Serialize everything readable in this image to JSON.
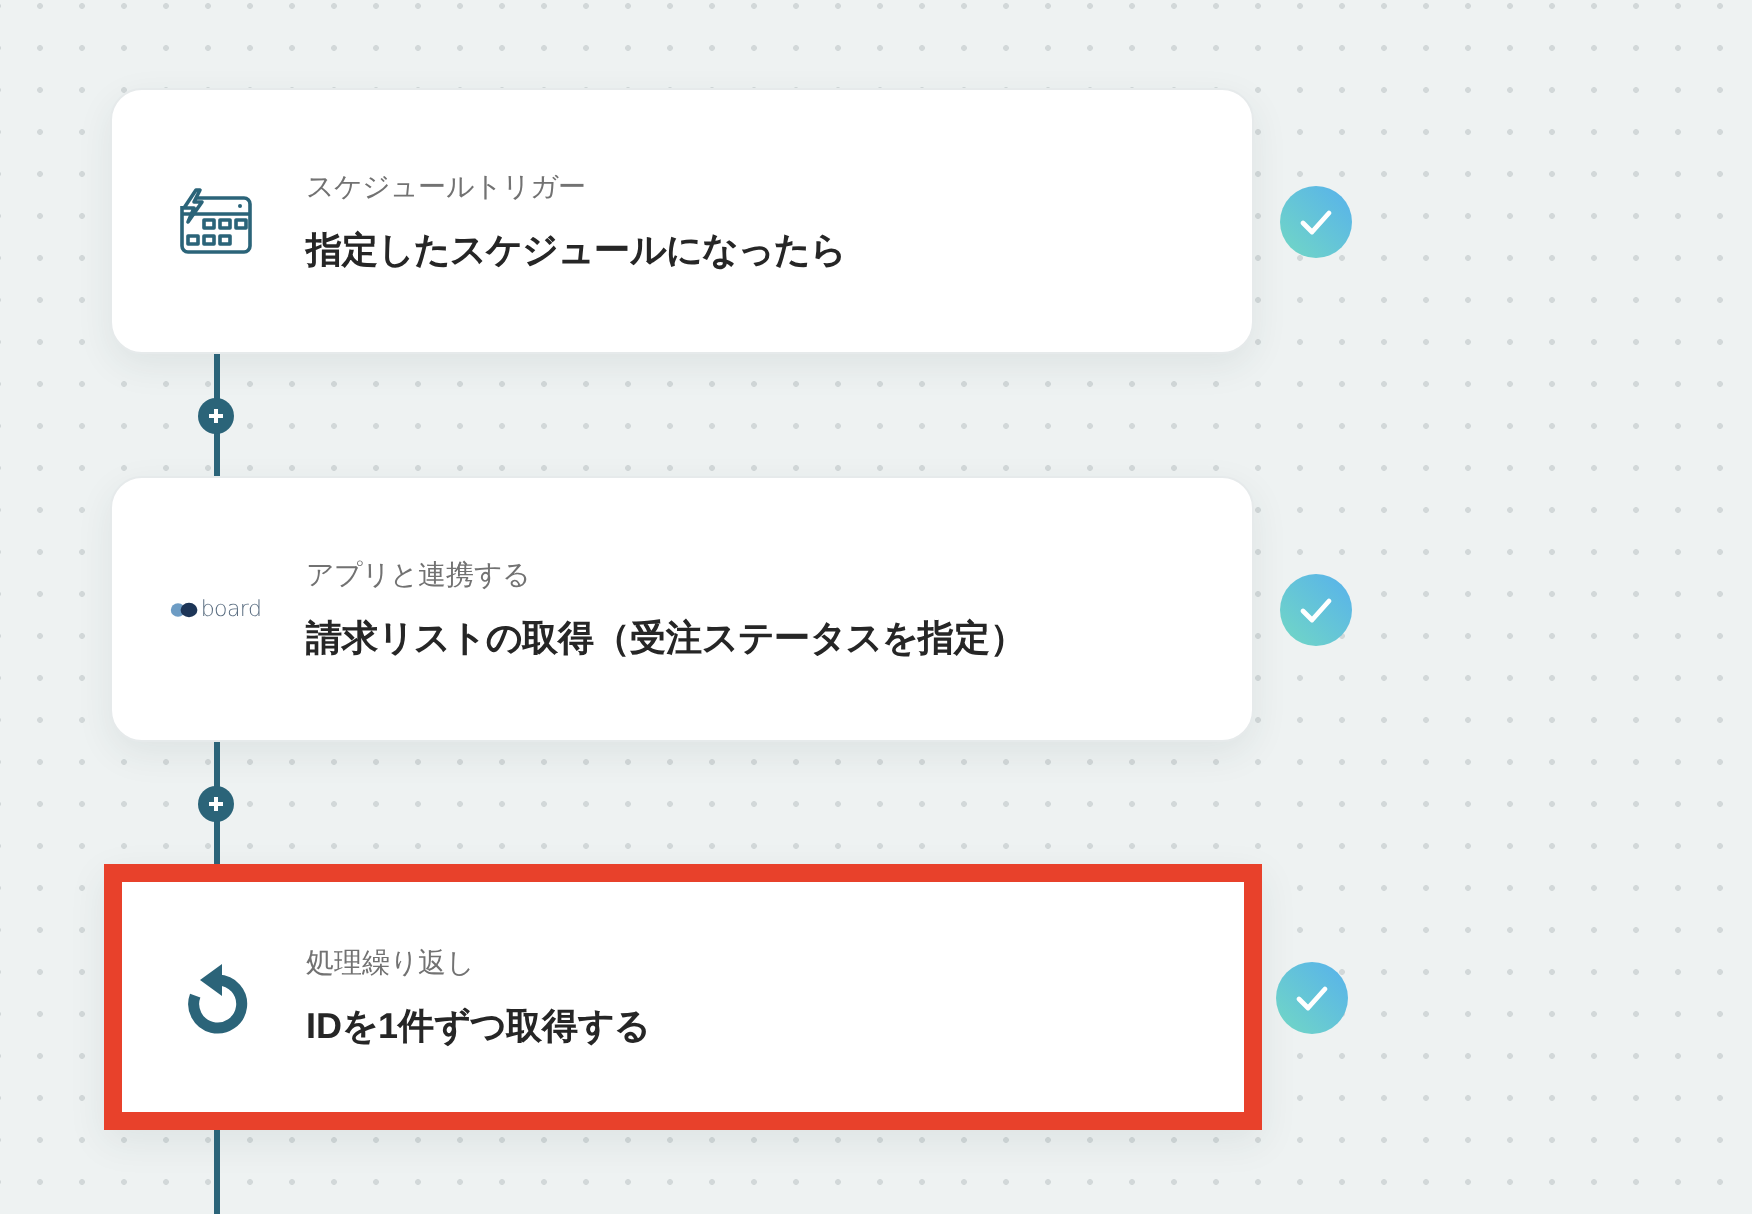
{
  "steps": [
    {
      "kind": "schedule",
      "label": "スケジュールトリガー",
      "title": "指定したスケジュールになったら",
      "done": true,
      "highlighted": false
    },
    {
      "kind": "app",
      "logo_text": "board",
      "label": "アプリと連携する",
      "title": "請求リストの取得（受注ステータスを指定）",
      "done": true,
      "highlighted": false
    },
    {
      "kind": "loop",
      "label": "処理繰り返し",
      "title": "IDを1件ずつ取得する",
      "done": true,
      "highlighted": true
    }
  ]
}
